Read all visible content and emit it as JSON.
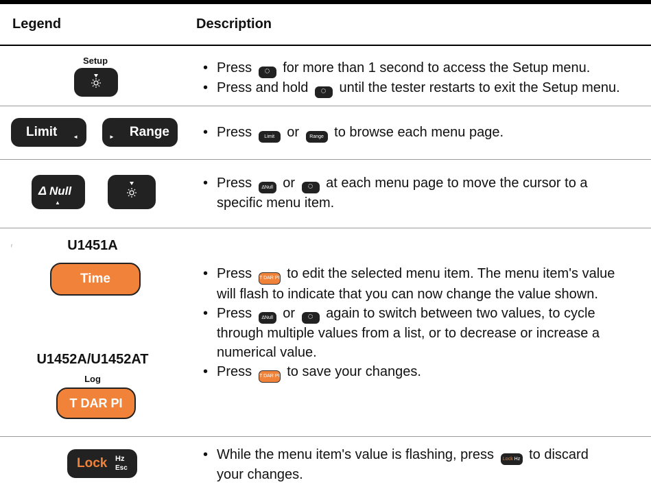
{
  "header": {
    "legend": "Legend",
    "description": "Description"
  },
  "rows": [
    {
      "legend": {
        "setup_label": "Setup"
      },
      "bullets": [
        [
          "Press",
          "for more than 1 second to access the Setup menu."
        ],
        [
          "Press and hold",
          "until the tester restarts to exit the Setup menu."
        ]
      ]
    },
    {
      "legend": {
        "limit_label": "Limit",
        "range_label": "Range"
      },
      "bullets": [
        [
          "Press",
          "or",
          "to browse each menu page."
        ]
      ]
    },
    {
      "legend": {
        "null_label": "Null"
      },
      "bullets": [
        [
          "Press",
          "or",
          "at each menu page to move the cursor to a",
          "specific menu item."
        ]
      ]
    },
    {
      "legend": {
        "model_a": "U1451A",
        "time_label": "Time",
        "model_b": "U1452A/U1452AT",
        "log_label": "Log",
        "tdarpi_label": "T DAR PI"
      },
      "bullets": [
        [
          "Press",
          "to edit the selected menu item. The menu item's value",
          "will flash to indicate that you can now change the value shown."
        ],
        [
          "Press",
          "or",
          "again to switch between two values, to cycle",
          "through multiple values from a list, or to decrease or increase a",
          "numerical value."
        ],
        [
          "Press",
          "to save your changes."
        ]
      ]
    },
    {
      "legend": {
        "lock_label": "Lock",
        "hz_label": "Hz",
        "esc_label": "Esc"
      },
      "bullets": [
        [
          "While the menu item's value is flashing, press",
          "to discard",
          "your changes."
        ]
      ]
    }
  ],
  "inline_keys": {
    "limit": "Limit",
    "range": "Range",
    "null": "ΔNull",
    "tdarpi": "T DAR PI",
    "lock": "Lock",
    "hz": "Hz"
  },
  "colors": {
    "orange_key": "#f0823a",
    "dark_key": "#222222"
  }
}
